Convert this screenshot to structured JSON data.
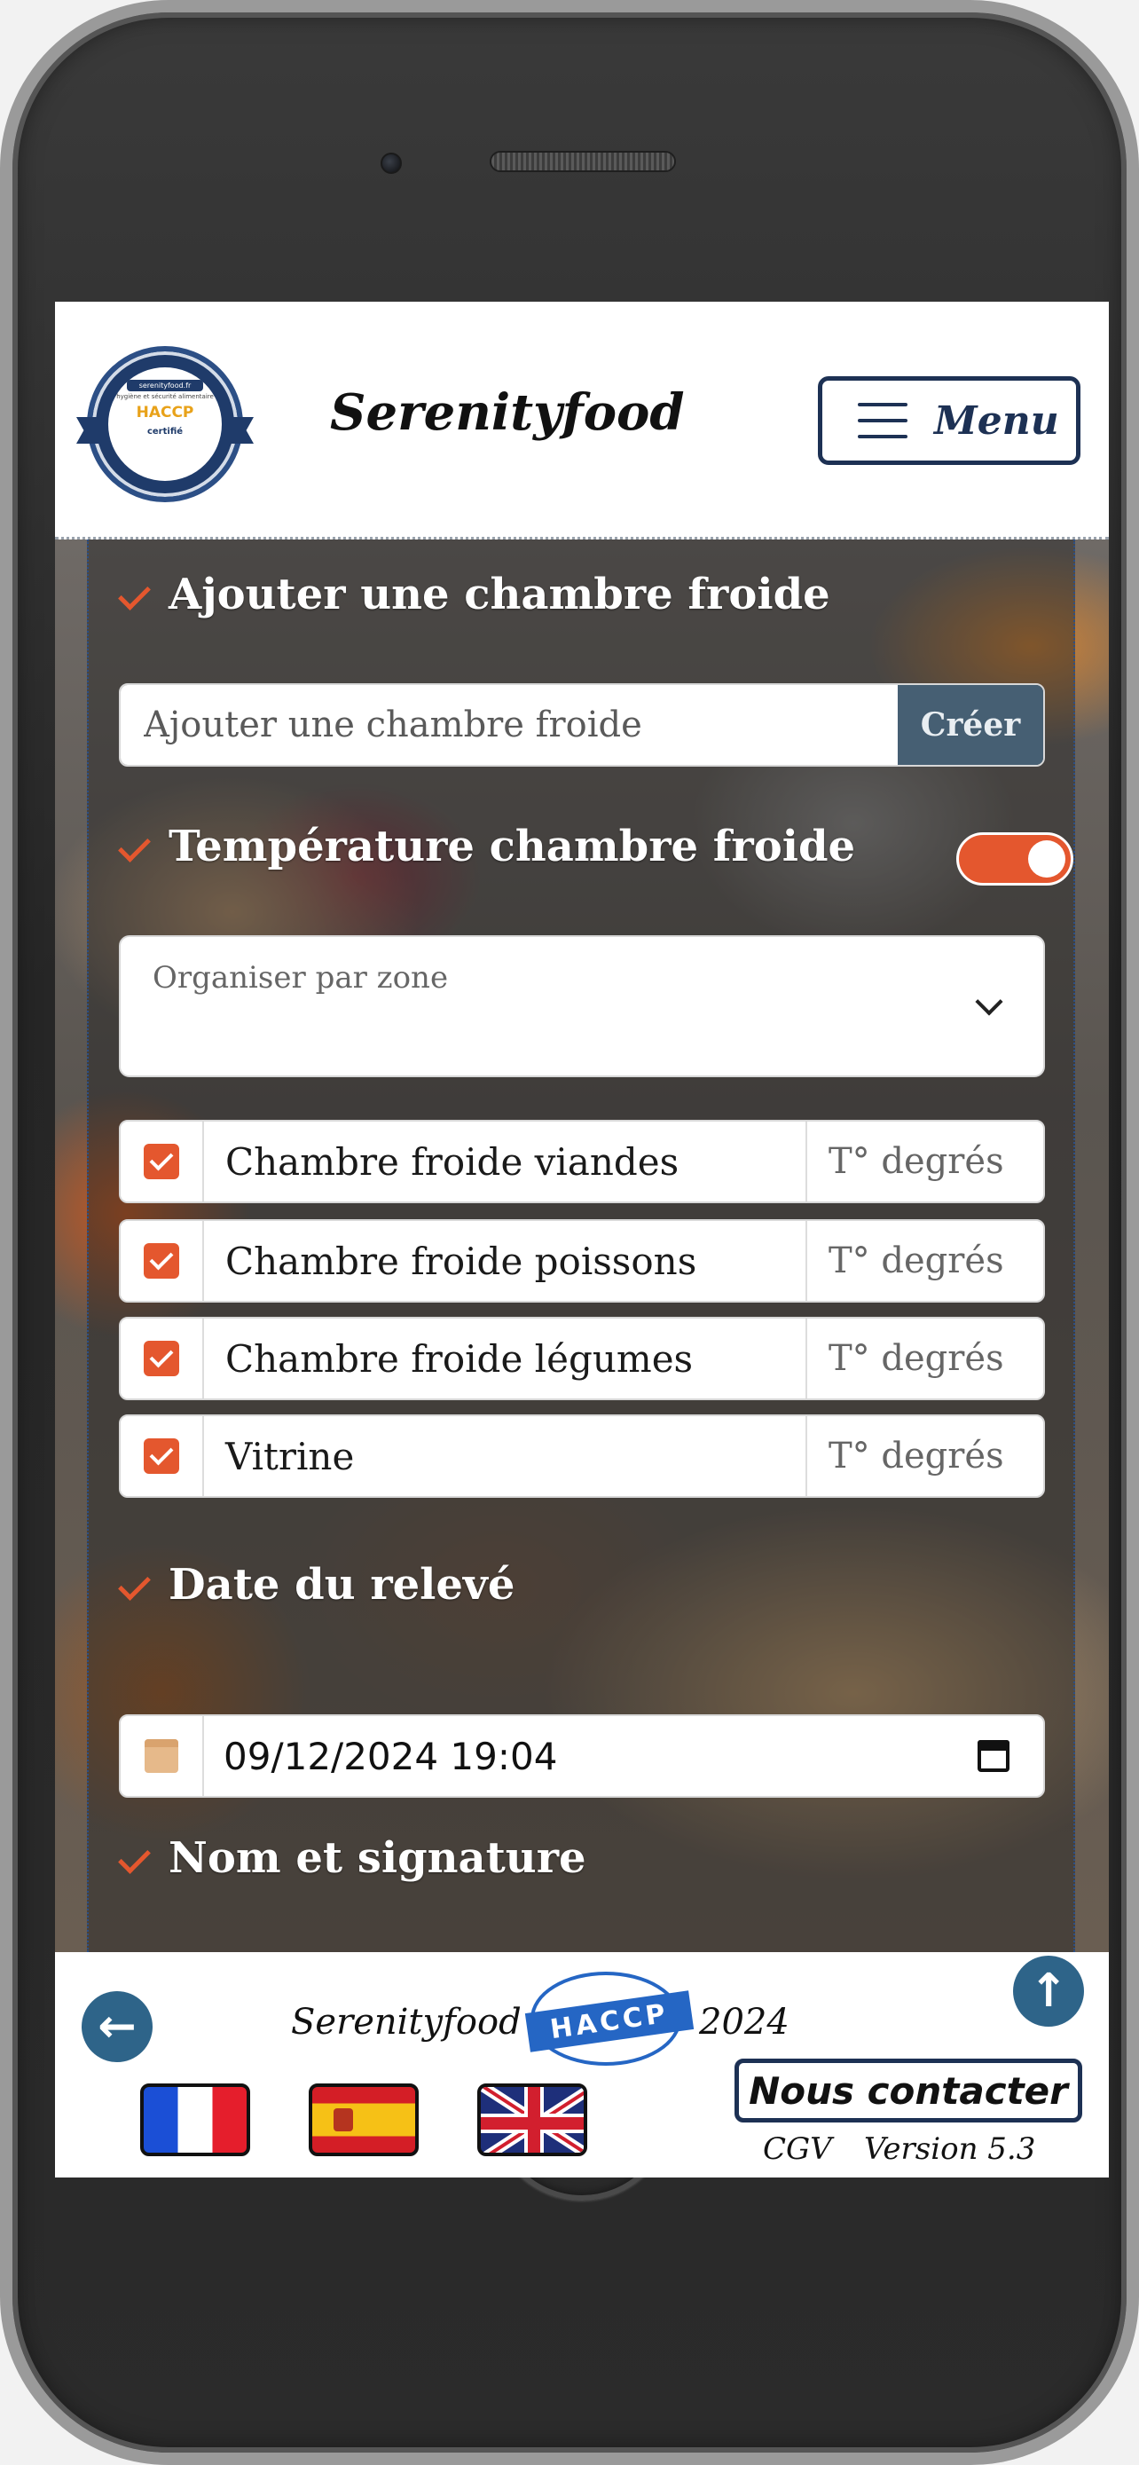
{
  "header": {
    "brand": "Serenityfood",
    "menu_label": "Menu",
    "logo": {
      "line1": "serenityfood.fr",
      "line2": "hygiène et sécurité alimentaire",
      "line3": "HACCP",
      "line4": "certifié"
    }
  },
  "add_cold_room": {
    "title": "Ajouter une chambre froide",
    "input_placeholder": "Ajouter une chambre froide",
    "create_label": "Créer"
  },
  "temperature": {
    "title": "Température chambre froide",
    "toggle_on": true,
    "zone_select_label": "Organiser par zone",
    "rooms": [
      {
        "name": "Chambre froide viandes",
        "temp_placeholder": "T° degrés",
        "checked": true
      },
      {
        "name": "Chambre froide poissons",
        "temp_placeholder": "T° degrés",
        "checked": true
      },
      {
        "name": "Chambre froide légumes",
        "temp_placeholder": "T° degrés",
        "checked": true
      },
      {
        "name": "Vitrine",
        "temp_placeholder": "T° degrés",
        "checked": true
      }
    ]
  },
  "date": {
    "title": "Date du relevé",
    "value": "09/12/2024 19:04"
  },
  "signature": {
    "title": "Nom et signature"
  },
  "footer": {
    "brand": "Serenityfood",
    "haccp": "HACCP",
    "year": "2024",
    "contact_label": "Nous contacter",
    "cgv": "CGV",
    "version": "Version 5.3",
    "back_glyph": "←",
    "up_glyph": "↑"
  },
  "colors": {
    "accent": "#e4572e",
    "navy": "#1d3154",
    "button_blue": "#2e6489",
    "create_btn": "#465f73"
  }
}
